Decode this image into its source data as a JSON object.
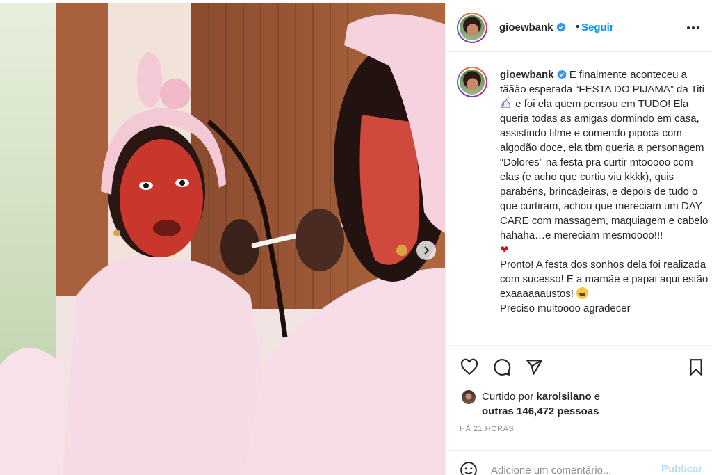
{
  "post": {
    "username": "gioewbank",
    "follow_label": "Seguir",
    "dot": "•",
    "caption_user": "gioewbank",
    "caption_parts": {
      "p1": "E finalmente aconteceu a tããão esperada “FESTA DO PIJAMA” da Titi",
      "p2": "e foi ela quem pensou em TUDO! Ela queria todas as amigas dormindo em casa, assistindo filme e comendo pipoca com algodão doce, ela tbm queria a personagem “Dolores” na festa pra curtir mtooooo com elas (e acho que curtiu viu kkkk), quis parabéns, brincadeiras, e depois de tudo o que curtiram, achou que mereciam um DAY CARE com massagem, maquiagem e cabelo hahaha…e mereciam mesmoooo!!!",
      "heart": "❤",
      "p3": "Pronto! A festa dos sonhos dela foi realizada com sucesso! E a mamãe e papai aqui estão exaaaaaaustos!",
      "p4": "Preciso muitoooo agradecer"
    },
    "likes_prefix": "Curtido por",
    "likes_user": "karolsilano",
    "likes_suffix": "e",
    "likes_others": "outras 146,472 pessoas",
    "time": "HÁ 21 HORAS",
    "comment_placeholder": "Adicione um comentário...",
    "post_label": "Publicar"
  },
  "icons": {
    "header_avatar": "avatar-icon",
    "verified": "verified-badge-icon",
    "more": "more-options-icon",
    "like": "heart-icon",
    "comment": "comment-icon",
    "share": "send-icon",
    "save": "bookmark-icon",
    "emoji": "emoji-smile-icon",
    "next": "chevron-right-icon"
  },
  "colors": {
    "accent": "#0095f6",
    "verified": "#3897f0",
    "post_disabled": "#b2dffc",
    "muted": "#8e8e8e"
  }
}
